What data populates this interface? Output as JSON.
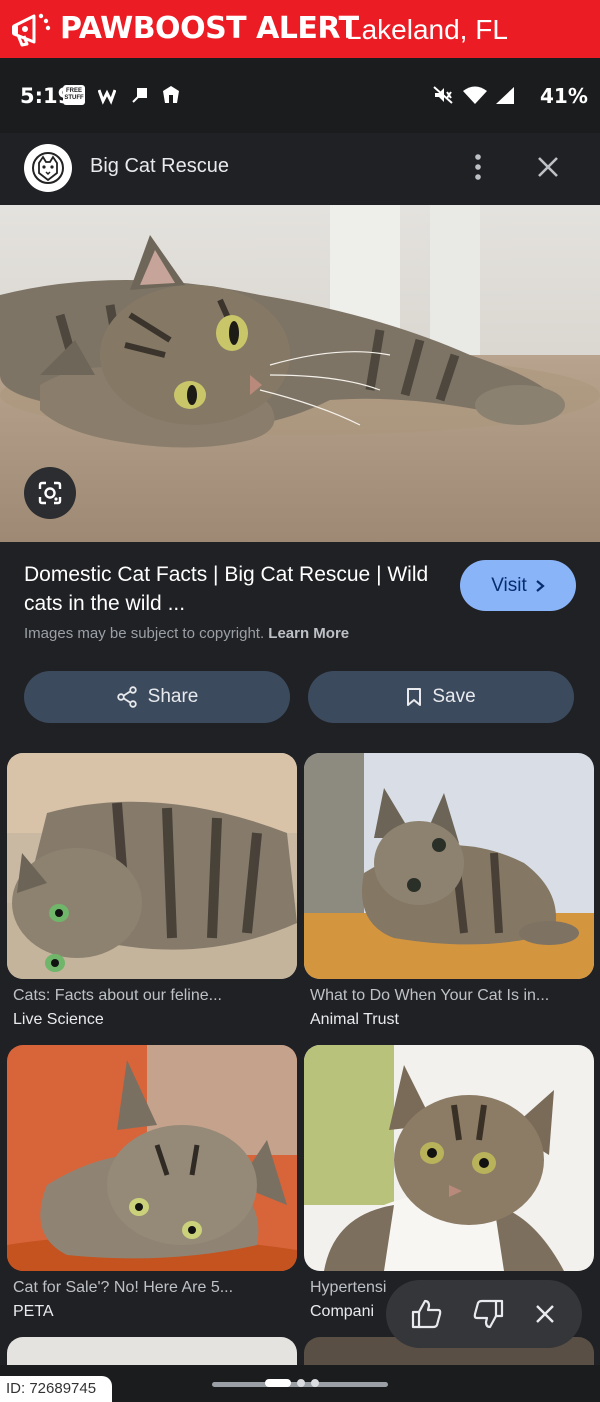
{
  "banner": {
    "brand": "PAWBOOST ALERT",
    "location": "Lakeland, FL",
    "color": "#ec1c24",
    "icon": "megaphone-paw-icon"
  },
  "status": {
    "time": "5:19",
    "free_badge": "FREE STUFF",
    "battery": "41%"
  },
  "header": {
    "site_name": "Big Cat Rescue",
    "more_icon": "more-vert-icon",
    "close_icon": "close-icon"
  },
  "result": {
    "title": "Domestic Cat Facts | Big Cat Rescue | Wild cats in the wild ...",
    "visit_label": "Visit",
    "copyright_text": "Images may be subject to copyright.",
    "learn_more": "Learn More",
    "share_label": "Share",
    "save_label": "Save"
  },
  "related": [
    {
      "title": "Cats: Facts about our feline...",
      "source": "Live Science"
    },
    {
      "title": "What to Do When Your Cat Is in...",
      "source": "Animal Trust"
    },
    {
      "title": "Cat for Sale'? No! Here Are 5...",
      "source": "PETA"
    },
    {
      "title": "Hypertensi",
      "source": "Compani"
    }
  ],
  "watermark": {
    "id": "ID: 72689745"
  },
  "colors": {
    "accent": "#8ab4f8",
    "button": "#3c4a5e",
    "background": "#202124"
  }
}
